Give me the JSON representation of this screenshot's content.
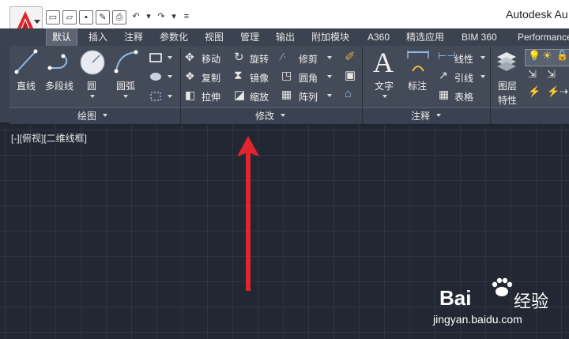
{
  "window": {
    "title": "Autodesk Au"
  },
  "quick_access": {
    "icons": [
      "new-file",
      "open-folder",
      "save",
      "save-as",
      "print",
      "undo",
      "dropdown",
      "redo",
      "dropdown",
      "customize"
    ]
  },
  "tabs": [
    {
      "label": "默认",
      "active": true
    },
    {
      "label": "插入"
    },
    {
      "label": "注释"
    },
    {
      "label": "参数化"
    },
    {
      "label": "视图"
    },
    {
      "label": "管理"
    },
    {
      "label": "输出"
    },
    {
      "label": "附加模块"
    },
    {
      "label": "A360"
    },
    {
      "label": "精选应用"
    },
    {
      "label": "BIM 360"
    },
    {
      "label": "Performance"
    }
  ],
  "panels": {
    "draw": {
      "label": "绘图",
      "tools": [
        "直线",
        "多段线",
        "圆",
        "圆弧"
      ]
    },
    "modify": {
      "label": "修改",
      "tools": [
        "移动",
        "旋转",
        "修剪",
        "复制",
        "镜像",
        "圆角",
        "拉伸",
        "缩放",
        "阵列"
      ]
    },
    "annotation": {
      "label": "注释",
      "tools": [
        "文字",
        "标注",
        "线性",
        "引线",
        "表格"
      ]
    },
    "layers": {
      "tools": [
        "图层",
        "特性"
      ]
    }
  },
  "viewport": {
    "label": "[-][俯视][二维线框]"
  },
  "watermark": {
    "brand": "Bai",
    "text": "经验",
    "url": "jingyan.baidu.com"
  },
  "colors": {
    "accent_red": "#e0262c",
    "ribbon_bg": "#444b58",
    "canvas_bg": "#222833"
  }
}
